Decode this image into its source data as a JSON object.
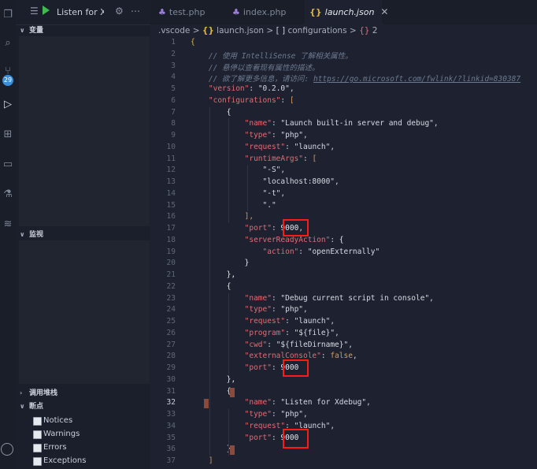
{
  "run_bar": {
    "config": "Listen for X"
  },
  "sidebar": {
    "variables_title": "变量",
    "watch_title": "监视",
    "callstack_title": "调用堆栈",
    "breakpoints_title": "断点",
    "breakpoints": [
      "Notices",
      "Warnings",
      "Errors",
      "Exceptions"
    ],
    "badge": "29"
  },
  "tabs": [
    {
      "label": "test.php",
      "icon": "php"
    },
    {
      "label": "index.php",
      "icon": "php"
    },
    {
      "label": "launch.json",
      "icon": "json",
      "active": true
    }
  ],
  "breadcrumb": {
    "folder": ".vscode",
    "sep": ">",
    "file": "launch.json",
    "arr": "configurations",
    "item": "2"
  },
  "editor": {
    "current_line": 32
  }
}
